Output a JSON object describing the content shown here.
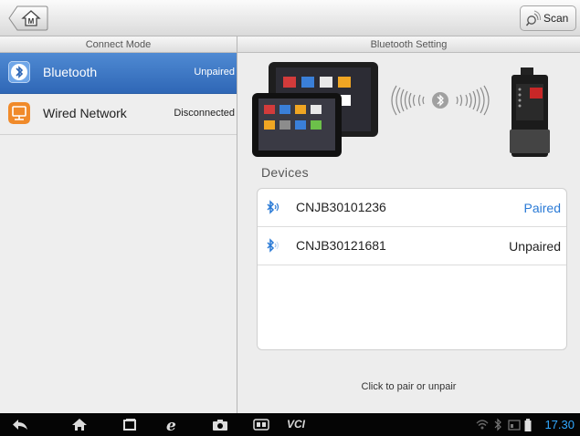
{
  "topbar": {
    "home_button": {
      "icon": "home-icon",
      "letter": "M"
    },
    "scan_button": {
      "label": "Scan",
      "icon": "scan-icon"
    }
  },
  "left_panel": {
    "header": "Connect Mode",
    "modes": [
      {
        "name": "Bluetooth",
        "status": "Unpaired",
        "icon": "bluetooth-icon",
        "selected": true
      },
      {
        "name": "Wired Network",
        "status": "Disconnected",
        "icon": "wired-network-icon",
        "selected": false
      }
    ]
  },
  "right_panel": {
    "header": "Bluetooth Setting",
    "devices_label": "Devices",
    "devices": [
      {
        "name": "CNJB30101236",
        "status": "Paired",
        "status_color": "#2a7ad6"
      },
      {
        "name": "CNJB30121681",
        "status": "Unpaired",
        "status_color": "#222222"
      }
    ],
    "hint": "Click to pair or unpair"
  },
  "system_bar": {
    "clock": "17.30",
    "vci_label": "VCI",
    "icons": [
      "back-icon",
      "home-icon",
      "recent-apps-icon",
      "browser-icon",
      "camera-icon",
      "vci-icon",
      "wifi-icon",
      "bluetooth-status-icon",
      "signal-icon",
      "battery-icon"
    ]
  },
  "colors": {
    "accent": "#2f67b6",
    "paired": "#2a7ad6",
    "clock": "#31a8ff"
  }
}
